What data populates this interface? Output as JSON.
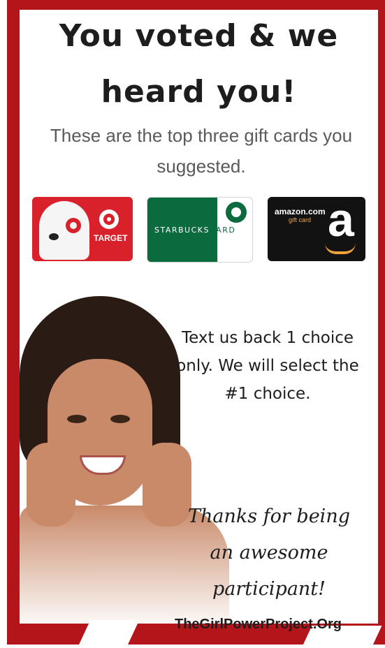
{
  "headline": {
    "line1": "You voted & we",
    "line2": "heard you!"
  },
  "subtitle": "These are the top three gift cards you suggested.",
  "gift_cards": {
    "target_label": "TARGET",
    "starbucks_label_white": "STARBUCKS",
    "starbucks_label_green": "CARD",
    "amazon_label": "amazon.com",
    "amazon_sub": "gift card",
    "amazon_logo_letter": "a"
  },
  "cta": "Text us back 1 choice only. We will select the #1 choice.",
  "thanks": "Thanks for being an awesome participant!",
  "footer": "TheGirlPowerProject.Org",
  "colors": {
    "frame_red": "#b4151b",
    "target_red": "#d9212b",
    "starbucks_green": "#0b6b3e",
    "amazon_orange": "#f2a23a"
  }
}
